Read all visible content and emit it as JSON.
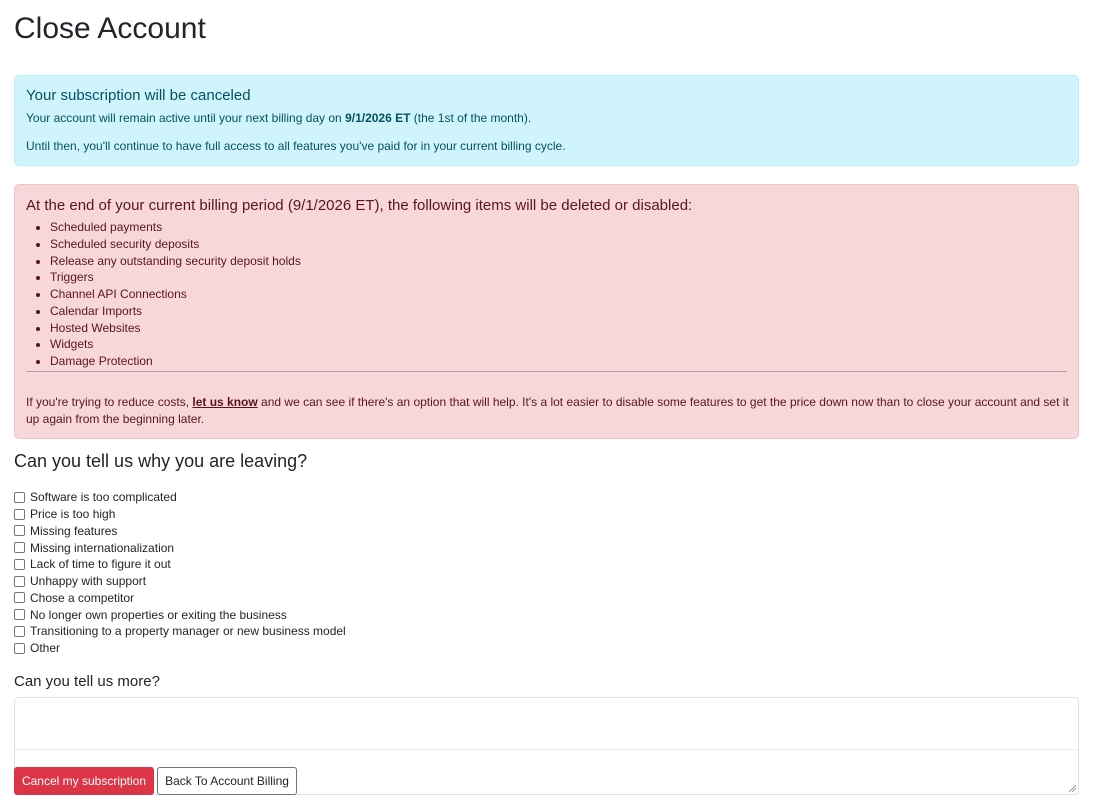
{
  "page_title": "Close Account",
  "info_alert": {
    "heading": "Your subscription will be canceled",
    "line1_prefix": "Your account will remain active until your next billing day on ",
    "line1_date": "9/1/2026 ET",
    "line1_suffix": " (the 1st of the month).",
    "line2": "Until then, you'll continue to have full access to all features you've paid for in your current billing cycle."
  },
  "danger_alert": {
    "heading": "At the end of your current billing period (9/1/2026 ET), the following items will be deleted or disabled:",
    "items": [
      "Scheduled payments",
      "Scheduled security deposits",
      "Release any outstanding security deposit holds",
      "Triggers",
      "Channel API Connections",
      "Calendar Imports",
      "Hosted Websites",
      "Widgets",
      "Damage Protection"
    ],
    "note_prefix": "If you're trying to reduce costs, ",
    "note_link": "let us know",
    "note_suffix": " and we can see if there's an option that will help. It's a lot easier to disable some features to get the price down now than to close your account and set it up again from the beginning later."
  },
  "reasons_heading": "Can you tell us why you are leaving?",
  "reasons": [
    "Software is too complicated",
    "Price is too high",
    "Missing features",
    "Missing internationalization",
    "Lack of time to figure it out",
    "Unhappy with support",
    "Chose a competitor",
    "No longer own properties or exiting the business",
    "Transitioning to a property manager or new business model",
    "Other"
  ],
  "more_heading": "Can you tell us more?",
  "more_value": "",
  "buttons": {
    "cancel": "Cancel my subscription",
    "back": "Back To Account Billing"
  }
}
